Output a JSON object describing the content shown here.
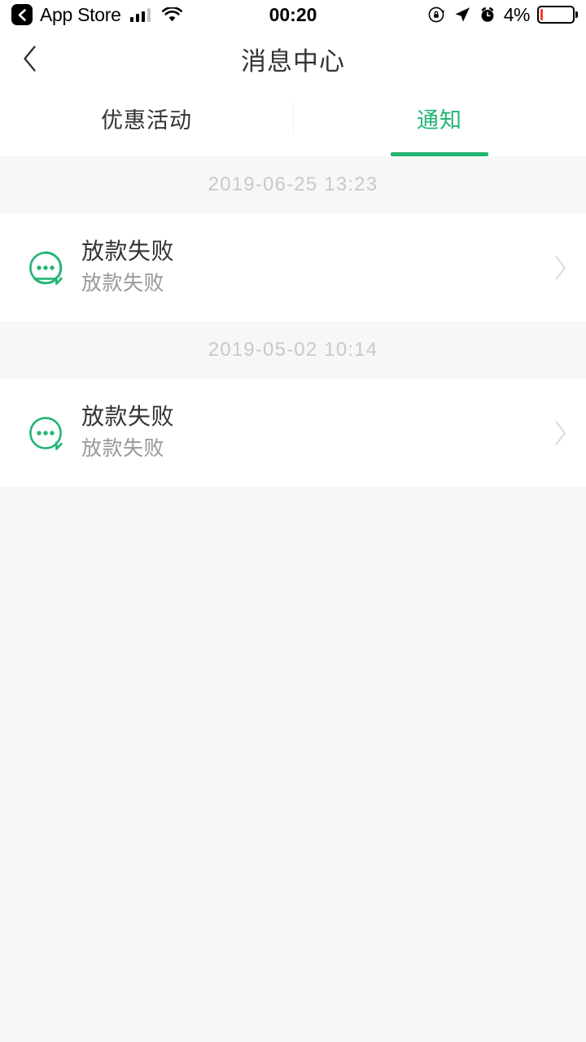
{
  "status_bar": {
    "back_app_label": "App Store",
    "back_icon": "chevron-left-badge-icon",
    "signal_icon": "cellular-signal-icon",
    "wifi_icon": "wifi-icon",
    "time": "00:20",
    "rotation_lock_icon": "rotation-lock-icon",
    "location_icon": "location-arrow-icon",
    "alarm_icon": "alarm-clock-icon",
    "battery_percent": "4%",
    "battery_level": 4,
    "battery_color": "#ff3b30"
  },
  "header": {
    "back_icon": "chevron-left-icon",
    "title": "消息中心"
  },
  "tabs": {
    "accent_color": "#22b573",
    "items": [
      {
        "label": "优惠活动",
        "active": false
      },
      {
        "label": "通知",
        "active": true
      }
    ]
  },
  "list": {
    "chevron_icon": "chevron-right-icon",
    "groups": [
      {
        "date": "2019-06-25 13:23",
        "messages": [
          {
            "icon": "chat-bubble-dots-icon",
            "icon_color": "#22b573",
            "title": "放款失败",
            "subtitle": "放款失败"
          }
        ]
      },
      {
        "date": "2019-05-02 10:14",
        "messages": [
          {
            "icon": "chat-bubble-dots-icon",
            "icon_color": "#22b573",
            "title": "放款失败",
            "subtitle": "放款失败"
          }
        ]
      }
    ]
  }
}
